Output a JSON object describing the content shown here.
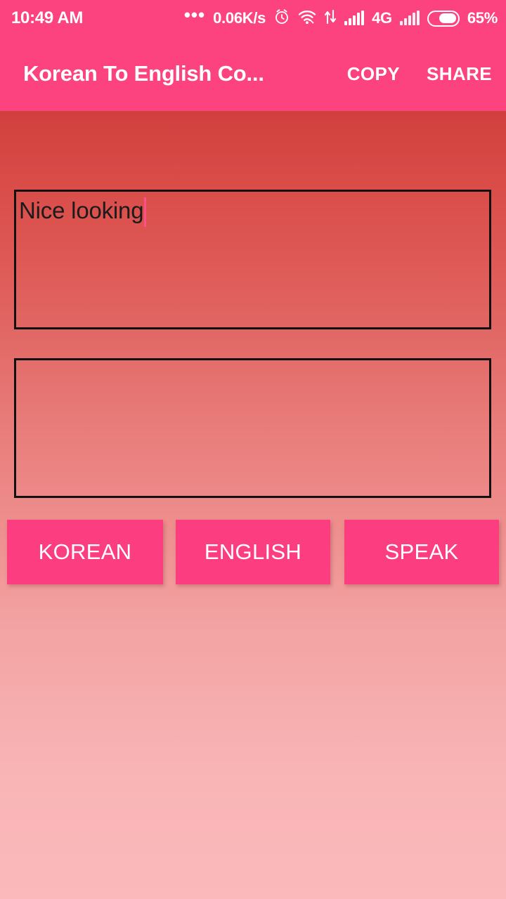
{
  "status_bar": {
    "clock": "10:49 AM",
    "overflow_dots": "•••",
    "network_speed": "0.06K/s",
    "network_type": "4G",
    "battery_percent": "65%",
    "battery_level": 65,
    "icons": [
      "alarm-icon",
      "wifi-icon",
      "data-transfer-icon",
      "signal-icon",
      "signal-icon-2",
      "battery-icon"
    ],
    "background_color": "#fc4380"
  },
  "app_bar": {
    "title": "Korean To English Co...",
    "copy_label": "COPY",
    "share_label": "SHARE",
    "background_color": "#fc4380"
  },
  "body": {
    "gradient_top_color": "#c93433",
    "gradient_mid_color": "#ef9093",
    "gradient_bottom_color": "#fbb9bb"
  },
  "input_box": {
    "value": "Nice looking",
    "placeholder": "",
    "border_color": "#111111",
    "caret_color": "#ff4f8b"
  },
  "output_box": {
    "value": "",
    "placeholder": "",
    "border_color": "#111111"
  },
  "buttons": {
    "korean_label": "KOREAN",
    "english_label": "ENGLISH",
    "speak_label": "SPEAK",
    "color": "#fc3d7f"
  }
}
